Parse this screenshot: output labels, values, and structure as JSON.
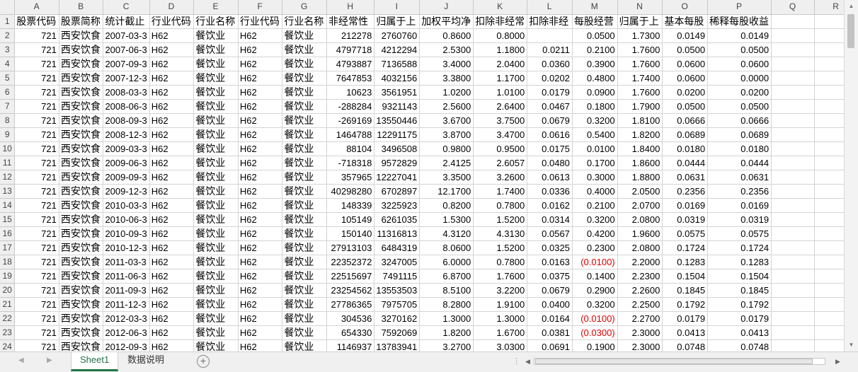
{
  "sheet": {
    "columns": [
      "A",
      "B",
      "C",
      "D",
      "E",
      "F",
      "G",
      "H",
      "I",
      "J",
      "K",
      "L",
      "M",
      "N",
      "O",
      "P",
      "Q",
      "R"
    ],
    "header_row": [
      "股票代码",
      "股票简称",
      "统计截止",
      "行业代码",
      "行业名称",
      "行业代码",
      "行业名称",
      "非经常性",
      "归属于上",
      "加权平均净",
      "扣除非经常",
      "扣除非经",
      "每股经营",
      "归属于上",
      "基本每股",
      "稀释每股收益",
      "",
      ""
    ],
    "rows": [
      [
        "721",
        "西安饮食",
        "2007-03-3",
        "H62",
        "餐饮业",
        "H62",
        "餐饮业",
        "212278",
        "2760760",
        "0.8600",
        "0.8000",
        "",
        "0.0500",
        "1.7300",
        "0.0149",
        "0.0149"
      ],
      [
        "721",
        "西安饮食",
        "2007-06-3",
        "H62",
        "餐饮业",
        "H62",
        "餐饮业",
        "4797718",
        "4212294",
        "2.5300",
        "1.1800",
        "0.0211",
        "0.2100",
        "1.7600",
        "0.0500",
        "0.0500"
      ],
      [
        "721",
        "西安饮食",
        "2007-09-3",
        "H62",
        "餐饮业",
        "H62",
        "餐饮业",
        "4793887",
        "7136588",
        "3.4000",
        "2.0400",
        "0.0360",
        "0.3900",
        "1.7600",
        "0.0600",
        "0.0600"
      ],
      [
        "721",
        "西安饮食",
        "2007-12-3",
        "H62",
        "餐饮业",
        "H62",
        "餐饮业",
        "7647853",
        "4032156",
        "3.3800",
        "1.1700",
        "0.0202",
        "0.4800",
        "1.7400",
        "0.0600",
        "0.0000"
      ],
      [
        "721",
        "西安饮食",
        "2008-03-3",
        "H62",
        "餐饮业",
        "H62",
        "餐饮业",
        "10623",
        "3561951",
        "1.0200",
        "1.0100",
        "0.0179",
        "0.0900",
        "1.7600",
        "0.0200",
        "0.0200"
      ],
      [
        "721",
        "西安饮食",
        "2008-06-3",
        "H62",
        "餐饮业",
        "H62",
        "餐饮业",
        "-288284",
        "9321143",
        "2.5600",
        "2.6400",
        "0.0467",
        "0.1800",
        "1.7900",
        "0.0500",
        "0.0500"
      ],
      [
        "721",
        "西安饮食",
        "2008-09-3",
        "H62",
        "餐饮业",
        "H62",
        "餐饮业",
        "-269169",
        "13550446",
        "3.6700",
        "3.7500",
        "0.0679",
        "0.3200",
        "1.8100",
        "0.0666",
        "0.0666"
      ],
      [
        "721",
        "西安饮食",
        "2008-12-3",
        "H62",
        "餐饮业",
        "H62",
        "餐饮业",
        "1464788",
        "12291175",
        "3.8700",
        "3.4700",
        "0.0616",
        "0.5400",
        "1.8200",
        "0.0689",
        "0.0689"
      ],
      [
        "721",
        "西安饮食",
        "2009-03-3",
        "H62",
        "餐饮业",
        "H62",
        "餐饮业",
        "88104",
        "3496508",
        "0.9800",
        "0.9500",
        "0.0175",
        "0.0100",
        "1.8400",
        "0.0180",
        "0.0180"
      ],
      [
        "721",
        "西安饮食",
        "2009-06-3",
        "H62",
        "餐饮业",
        "H62",
        "餐饮业",
        "-718318",
        "9572829",
        "2.4125",
        "2.6057",
        "0.0480",
        "0.1700",
        "1.8600",
        "0.0444",
        "0.0444"
      ],
      [
        "721",
        "西安饮食",
        "2009-09-3",
        "H62",
        "餐饮业",
        "H62",
        "餐饮业",
        "357965",
        "12227041",
        "3.3500",
        "3.2600",
        "0.0613",
        "0.3000",
        "1.8800",
        "0.0631",
        "0.0631"
      ],
      [
        "721",
        "西安饮食",
        "2009-12-3",
        "H62",
        "餐饮业",
        "H62",
        "餐饮业",
        "40298280",
        "6702897",
        "12.1700",
        "1.7400",
        "0.0336",
        "0.4000",
        "2.0500",
        "0.2356",
        "0.2356"
      ],
      [
        "721",
        "西安饮食",
        "2010-03-3",
        "H62",
        "餐饮业",
        "H62",
        "餐饮业",
        "148339",
        "3225923",
        "0.8200",
        "0.7800",
        "0.0162",
        "0.2100",
        "2.0700",
        "0.0169",
        "0.0169"
      ],
      [
        "721",
        "西安饮食",
        "2010-06-3",
        "H62",
        "餐饮业",
        "H62",
        "餐饮业",
        "105149",
        "6261035",
        "1.5300",
        "1.5200",
        "0.0314",
        "0.3200",
        "2.0800",
        "0.0319",
        "0.0319"
      ],
      [
        "721",
        "西安饮食",
        "2010-09-3",
        "H62",
        "餐饮业",
        "H62",
        "餐饮业",
        "150140",
        "11316813",
        "4.3120",
        "4.3130",
        "0.0567",
        "0.4200",
        "1.9600",
        "0.0575",
        "0.0575"
      ],
      [
        "721",
        "西安饮食",
        "2010-12-3",
        "H62",
        "餐饮业",
        "H62",
        "餐饮业",
        "27913103",
        "6484319",
        "8.0600",
        "1.5200",
        "0.0325",
        "0.2300",
        "2.0800",
        "0.1724",
        "0.1724"
      ],
      [
        "721",
        "西安饮食",
        "2011-03-3",
        "H62",
        "餐饮业",
        "H62",
        "餐饮业",
        "22352372",
        "3247005",
        "6.0000",
        "0.7800",
        "0.0163",
        "(0.0100)",
        "2.2000",
        "0.1283",
        "0.1283"
      ],
      [
        "721",
        "西安饮食",
        "2011-06-3",
        "H62",
        "餐饮业",
        "H62",
        "餐饮业",
        "22515697",
        "7491115",
        "6.8700",
        "1.7600",
        "0.0375",
        "0.1400",
        "2.2300",
        "0.1504",
        "0.1504"
      ],
      [
        "721",
        "西安饮食",
        "2011-09-3",
        "H62",
        "餐饮业",
        "H62",
        "餐饮业",
        "23254562",
        "13553503",
        "8.5100",
        "3.2200",
        "0.0679",
        "0.2900",
        "2.2600",
        "0.1845",
        "0.1845"
      ],
      [
        "721",
        "西安饮食",
        "2011-12-3",
        "H62",
        "餐饮业",
        "H62",
        "餐饮业",
        "27786365",
        "7975705",
        "8.2800",
        "1.9100",
        "0.0400",
        "0.3200",
        "2.2500",
        "0.1792",
        "0.1792"
      ],
      [
        "721",
        "西安饮食",
        "2012-03-3",
        "H62",
        "餐饮业",
        "H62",
        "餐饮业",
        "304536",
        "3270162",
        "1.3000",
        "1.3000",
        "0.0164",
        "(0.0100)",
        "2.2700",
        "0.0179",
        "0.0179"
      ],
      [
        "721",
        "西安饮食",
        "2012-06-3",
        "H62",
        "餐饮业",
        "H62",
        "餐饮业",
        "654330",
        "7592069",
        "1.8200",
        "1.6700",
        "0.0381",
        "(0.0300)",
        "2.3000",
        "0.0413",
        "0.0413"
      ],
      [
        "721",
        "西安饮食",
        "2012-09-3",
        "H62",
        "餐饮业",
        "H62",
        "餐饮业",
        "1146937",
        "13783941",
        "3.2700",
        "3.0300",
        "0.0691",
        "0.1900",
        "2.3000",
        "0.0748",
        "0.0748"
      ]
    ]
  },
  "tabs": {
    "active": "Sheet1",
    "second": "数据说明",
    "add_symbol": "+"
  },
  "colors": {
    "negative": "#e00000",
    "accent": "#217346"
  }
}
